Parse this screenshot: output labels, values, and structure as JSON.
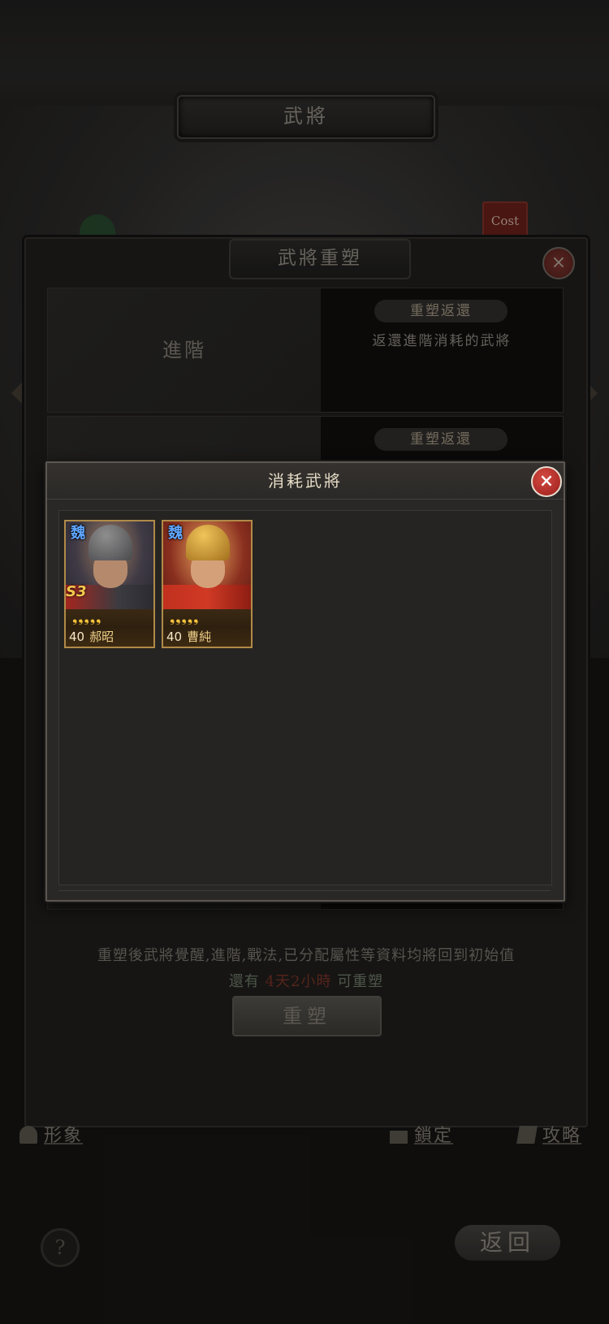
{
  "screen": {
    "title": "武將",
    "cost_tag": "Cost"
  },
  "rebuild_panel": {
    "title": "武將重塑",
    "close_icon": "×",
    "rows": [
      {
        "left_label": "進階",
        "pill": "重塑返還",
        "description": "返還進階消耗的武將"
      },
      {
        "left_label": "",
        "pill": "重塑返還",
        "description": ""
      }
    ],
    "note": "重塑後武將覺醒,進階,戰法,已分配屬性等資料均將回到初始值",
    "cooldown_prefix": "還有",
    "cooldown_time": "4天2小時",
    "cooldown_suffix": "可重塑",
    "rebuild_button": "重塑"
  },
  "bottom_tools": {
    "appearance": "形象",
    "lock": "鎖定",
    "strategy": "攻略",
    "help": "?",
    "back": "返回"
  },
  "modal": {
    "title": "消耗武將",
    "close_icon": "×",
    "generals": [
      {
        "faction": "魏",
        "grade": "S3",
        "stars": "❟❟❟❟❟",
        "level": "40",
        "name": "郝昭"
      },
      {
        "faction": "魏",
        "grade": "",
        "stars": "❟❟❟❟❟",
        "level": "40",
        "name": "曹純"
      }
    ]
  },
  "colors": {
    "accent_gold": "#b08a48",
    "close_red": "#c0332b",
    "faction_blue": "#5fa6ff",
    "cooldown_red": "#6a2c22"
  }
}
